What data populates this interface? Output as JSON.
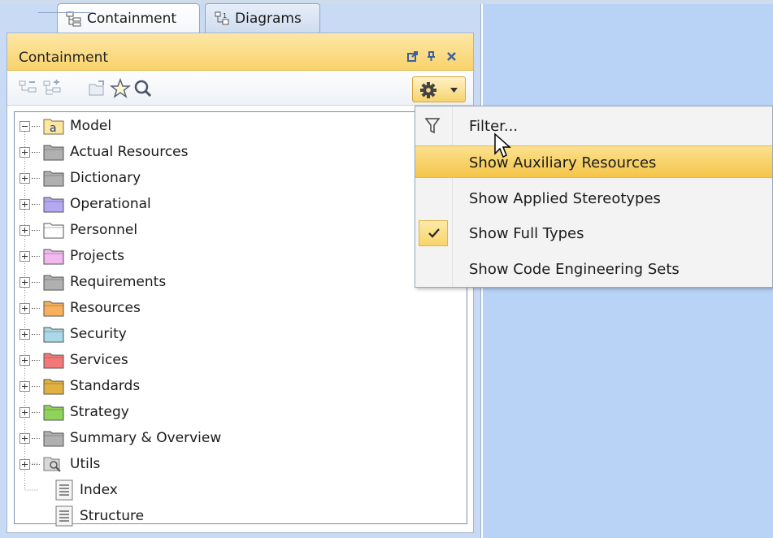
{
  "tabs": [
    {
      "label": "Containment",
      "active": true,
      "icon": "containment-tree-icon"
    },
    {
      "label": "Diagrams",
      "active": false,
      "icon": "diagrams-icon"
    }
  ],
  "panel": {
    "title": "Containment",
    "controls": [
      "undock-icon",
      "pin-icon",
      "close-icon"
    ]
  },
  "toolbar": {
    "buttons": [
      "collapse-icon",
      "expand-icon",
      "open-folder-icon",
      "star-icon",
      "search-icon"
    ],
    "options_button": "gear-icon"
  },
  "tree": {
    "root": {
      "label": "Model",
      "icon": "model-package-icon",
      "expanded": true
    },
    "items": [
      {
        "label": "Actual Resources",
        "color": "#b0b0b0",
        "expandable": true
      },
      {
        "label": "Dictionary",
        "color": "#b0b0b0",
        "expandable": true
      },
      {
        "label": "Operational",
        "color": "#b3a8f2",
        "expandable": true
      },
      {
        "label": "Personnel",
        "color": "#ffffff",
        "expandable": true
      },
      {
        "label": "Projects",
        "color": "#f3b8f0",
        "expandable": true
      },
      {
        "label": "Requirements",
        "color": "#b0b0b0",
        "expandable": true
      },
      {
        "label": "Resources",
        "color": "#f8b05c",
        "expandable": true
      },
      {
        "label": "Security",
        "color": "#a9d8e8",
        "expandable": true
      },
      {
        "label": "Services",
        "color": "#f47878",
        "expandable": true
      },
      {
        "label": "Standards",
        "color": "#e2b23e",
        "expandable": true
      },
      {
        "label": "Strategy",
        "color": "#8fd45a",
        "expandable": true
      },
      {
        "label": "Summary & Overview",
        "color": "#b0b0b0",
        "expandable": true
      },
      {
        "label": "Utils",
        "color": "#c0c0c0",
        "expandable": true,
        "icon": "utils-package-icon"
      },
      {
        "label": "Index",
        "expandable": false,
        "icon": "document-icon"
      },
      {
        "label": "Structure",
        "expandable": false,
        "icon": "document-icon"
      }
    ]
  },
  "menu": {
    "items": [
      {
        "label": "Filter...",
        "icon": "filter-icon",
        "highlighted": false,
        "checked": false
      },
      {
        "label": "Show Auxiliary Resources",
        "highlighted": true,
        "checked": false
      },
      {
        "label": "Show Applied Stereotypes",
        "highlighted": false,
        "checked": false
      },
      {
        "label": "Show Full Types",
        "highlighted": false,
        "checked": true,
        "icon": "check-icon"
      },
      {
        "label": "Show Code Engineering Sets",
        "highlighted": false,
        "checked": false
      }
    ]
  },
  "colors": {
    "frame": "#c9daf4",
    "header": "#f9d36b",
    "highlight": "#f4c548"
  }
}
